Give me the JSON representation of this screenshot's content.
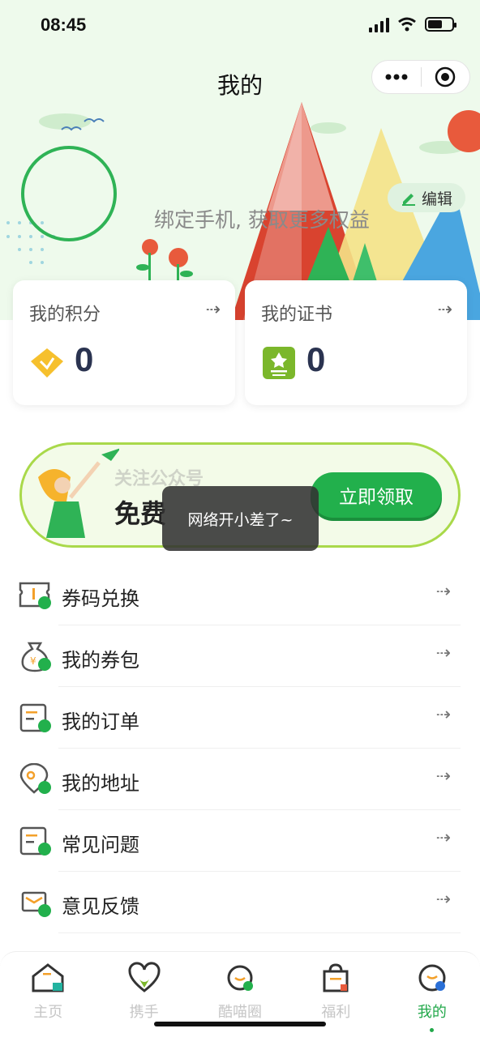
{
  "status_bar": {
    "time": "08:45"
  },
  "nav": {
    "title": "我的",
    "more_icon": "more-dots-icon",
    "close_icon": "target-circle-icon"
  },
  "profile": {
    "bind_prompt": "绑定手机, 获取更多权益",
    "edit_label": "编辑"
  },
  "cards": [
    {
      "title": "我的积分",
      "value": "0",
      "icon": "diamond-points-icon",
      "arrow": "⇢"
    },
    {
      "title": "我的证书",
      "value": "0",
      "icon": "certificate-icon",
      "arrow": "⇢"
    }
  ],
  "banner": {
    "subtitle": "关注公众号",
    "main": "免费",
    "button": "立即领取"
  },
  "toast": {
    "text": "网络开小差了~"
  },
  "menu": [
    {
      "label": "券码兑换",
      "icon": "ticket-icon",
      "arrow": "⇢"
    },
    {
      "label": "我的券包",
      "icon": "money-bag-icon",
      "arrow": "⇢"
    },
    {
      "label": "我的订单",
      "icon": "order-list-icon",
      "arrow": "⇢"
    },
    {
      "label": "我的地址",
      "icon": "location-pin-icon",
      "arrow": "⇢"
    },
    {
      "label": "常见问题",
      "icon": "faq-doc-icon",
      "arrow": "⇢"
    },
    {
      "label": "意见反馈",
      "icon": "feedback-mail-icon",
      "arrow": "⇢"
    }
  ],
  "tabs": [
    {
      "label": "主页",
      "icon": "home-icon",
      "active": false
    },
    {
      "label": "携手",
      "icon": "heart-icon",
      "active": false
    },
    {
      "label": "酷喵圈",
      "icon": "planet-icon",
      "active": false
    },
    {
      "label": "福利",
      "icon": "gift-bag-icon",
      "active": false
    },
    {
      "label": "我的",
      "icon": "profile-face-icon",
      "active": true
    }
  ],
  "colors": {
    "accent": "#22b04c",
    "hero_bg": "#eefaec",
    "value_text": "#2a3350"
  }
}
